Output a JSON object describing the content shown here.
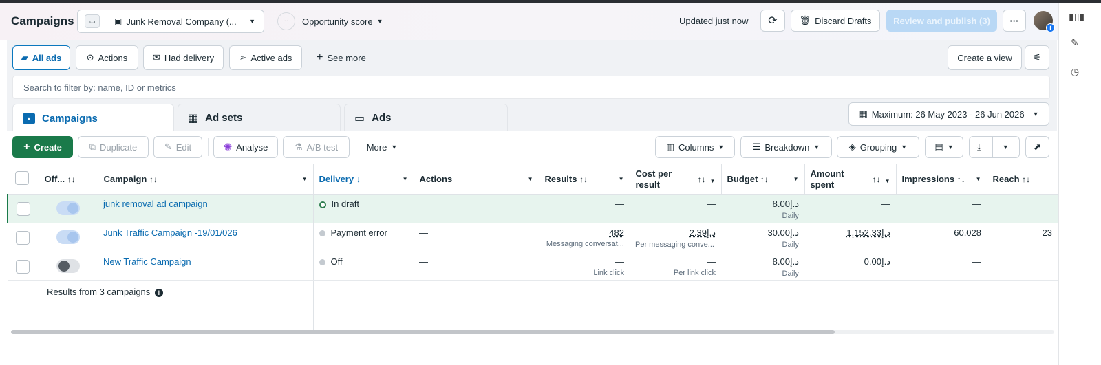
{
  "header": {
    "title": "Campaigns",
    "account_name": "Junk Removal Company (...",
    "opportunity_label": "Opportunity score",
    "updated_text": "Updated just now",
    "discard_label": "Discard Drafts",
    "review_label": "Review and publish (3)",
    "more_label": "···"
  },
  "filters": {
    "all_ads": "All ads",
    "actions": "Actions",
    "had_delivery": "Had delivery",
    "active_ads": "Active ads",
    "see_more": "See more",
    "create_view": "Create a view"
  },
  "search": {
    "placeholder": "Search to filter by: name, ID or metrics"
  },
  "tabs": {
    "campaigns": "Campaigns",
    "ad_sets": "Ad sets",
    "ads": "Ads"
  },
  "date_range": "Maximum: 26 May 2023 - 26 Jun 2026",
  "toolbar": {
    "create": "Create",
    "duplicate": "Duplicate",
    "edit": "Edit",
    "analyse": "Analyse",
    "ab_test": "A/B test",
    "more": "More",
    "columns": "Columns",
    "breakdown": "Breakdown",
    "grouping": "Grouping"
  },
  "table": {
    "headers": {
      "off_on": "Off...",
      "campaign": "Campaign",
      "delivery": "Delivery",
      "actions": "Actions",
      "results": "Results",
      "cost_per_result_1": "Cost per",
      "cost_per_result_2": "result",
      "budget": "Budget",
      "amount_spent_1": "Amount",
      "amount_spent_2": "spent",
      "impressions": "Impressions",
      "reach": "Reach"
    },
    "sort_glyph": "↑↓",
    "delivery_sort_glyph": "↓",
    "rows": [
      {
        "name": "junk removal ad campaign",
        "delivery": "In draft",
        "actions": "",
        "results": "—",
        "results_sub": "",
        "cost": "—",
        "cost_sub": "",
        "budget": "د.إ8.00",
        "budget_sub": "Daily",
        "spent": "—",
        "impressions": "—",
        "reach": ""
      },
      {
        "name": "Junk Traffic Campaign -19/01/026",
        "delivery": "Payment error",
        "actions": "—",
        "results": "482",
        "results_sub": "Messaging conversat...",
        "cost": "د.إ2.39",
        "cost_sub": "Per messaging conve...",
        "budget": "د.إ30.00",
        "budget_sub": "Daily",
        "spent": "د.إ1,152.33",
        "impressions": "60,028",
        "reach": "23"
      },
      {
        "name": "New Traffic Campaign",
        "delivery": "Off",
        "actions": "—",
        "results": "—",
        "results_sub": "Link click",
        "cost": "—",
        "cost_sub": "Per link click",
        "budget": "د.إ8.00",
        "budget_sub": "Daily",
        "spent": "د.إ0.00",
        "impressions": "—",
        "reach": ""
      }
    ],
    "summary": "Results from 3 campaigns"
  }
}
